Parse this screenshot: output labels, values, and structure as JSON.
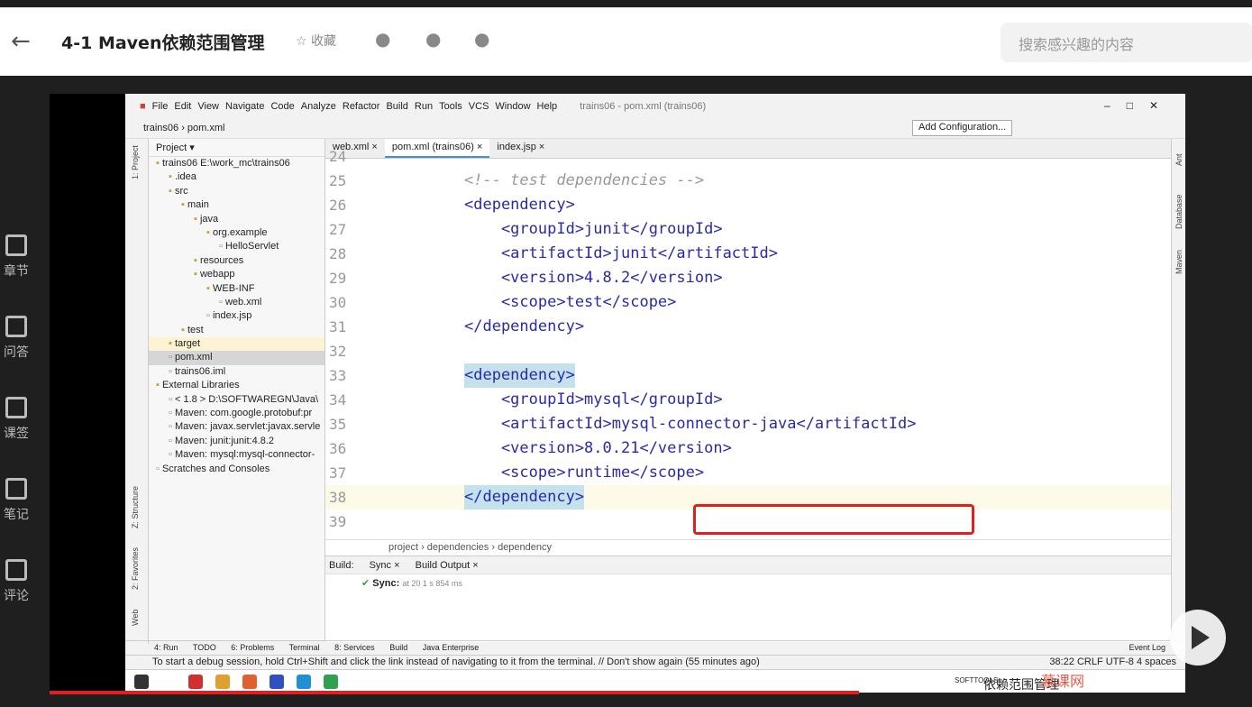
{
  "header": {
    "title": "4-1 Maven依赖范围管理",
    "favorite_label": "收藏",
    "search_placeholder": "搜索感兴趣的内容"
  },
  "left_nav": [
    "章节",
    "问答",
    "课签",
    "笔记",
    "评论"
  ],
  "ide": {
    "menu": [
      "File",
      "Edit",
      "View",
      "Navigate",
      "Code",
      "Analyze",
      "Refactor",
      "Build",
      "Run",
      "Tools",
      "VCS",
      "Window",
      "Help"
    ],
    "window_title": "trains06 - pom.xml (trains06)",
    "nav_path": "trains06 › pom.xml",
    "add_config": "Add Configuration...",
    "project_label": "Project",
    "tree": [
      {
        "text": "trains06  E:\\work_mc\\trains06",
        "depth": 0
      },
      {
        "text": ".idea",
        "depth": 1
      },
      {
        "text": "src",
        "depth": 1
      },
      {
        "text": "main",
        "depth": 2
      },
      {
        "text": "java",
        "depth": 3
      },
      {
        "text": "org.example",
        "depth": 4
      },
      {
        "text": "HelloServlet",
        "depth": 5
      },
      {
        "text": "resources",
        "depth": 3
      },
      {
        "text": "webapp",
        "depth": 3
      },
      {
        "text": "WEB-INF",
        "depth": 4
      },
      {
        "text": "web.xml",
        "depth": 5
      },
      {
        "text": "index.jsp",
        "depth": 4
      },
      {
        "text": "test",
        "depth": 2
      },
      {
        "text": "target",
        "depth": 1
      },
      {
        "text": "pom.xml",
        "depth": 1
      },
      {
        "text": "trains06.iml",
        "depth": 1
      },
      {
        "text": "External Libraries",
        "depth": 0
      },
      {
        "text": "< 1.8 >  D:\\SOFTWAREGN\\Java\\",
        "depth": 1
      },
      {
        "text": "Maven: com.google.protobuf:pr",
        "depth": 1
      },
      {
        "text": "Maven: javax.servlet:javax.servle",
        "depth": 1
      },
      {
        "text": "Maven: junit:junit:4.8.2",
        "depth": 1
      },
      {
        "text": "Maven: mysql:mysql-connector-",
        "depth": 1
      },
      {
        "text": "Scratches and Consoles",
        "depth": 0
      }
    ],
    "tabs": [
      "web.xml",
      "pom.xml (trains06)",
      "index.jsp"
    ],
    "code_lines": [
      {
        "n": "24",
        "code": ""
      },
      {
        "n": "25",
        "code": "<!-- test dependencies -->"
      },
      {
        "n": "26",
        "code": "<dependency>"
      },
      {
        "n": "27",
        "code": "    <groupId>junit</groupId>"
      },
      {
        "n": "28",
        "code": "    <artifactId>junit</artifactId>"
      },
      {
        "n": "29",
        "code": "    <version>4.8.2</version>"
      },
      {
        "n": "30",
        "code": "    <scope>test</scope>"
      },
      {
        "n": "31",
        "code": "</dependency>"
      },
      {
        "n": "32",
        "code": ""
      },
      {
        "n": "33",
        "code": "<dependency>"
      },
      {
        "n": "34",
        "code": "    <groupId>mysql</groupId>"
      },
      {
        "n": "35",
        "code": "    <artifactId>mysql-connector-java</artifactId>"
      },
      {
        "n": "36",
        "code": "    <version>8.0.21</version>"
      },
      {
        "n": "37",
        "code": "    <scope>runtime</scope>"
      },
      {
        "n": "38",
        "code": "</dependency>"
      },
      {
        "n": "39",
        "code": ""
      }
    ],
    "breadcrumb": "project › dependencies › dependency",
    "build": {
      "label": "Build:",
      "tabs": [
        "Sync",
        "Build Output"
      ],
      "sync_text": "Sync:",
      "sync_time": "at 20 1 s 854 ms"
    },
    "left_tool_labels": [
      "1: Project",
      "Z: Structure",
      "2: Favorites",
      "Web"
    ],
    "right_tool_labels": [
      "Ant",
      "Database",
      "Maven"
    ],
    "bottom_tabs": [
      "4: Run",
      "TODO",
      "6: Problems",
      "Terminal",
      "8: Services",
      "Build",
      "Java Enterprise"
    ],
    "event_log": "Event Log",
    "status_message": "To start a debug session, hold Ctrl+Shift and click the link instead of navigating to it from the terminal. // Don't show again (55 minutes ago)",
    "status_right": "38:22  CRLF  UTF-8  4 spaces",
    "taskbar_label": "SOFTTOOLS"
  },
  "caption": "依赖范围管理",
  "watermark": "慕课网"
}
